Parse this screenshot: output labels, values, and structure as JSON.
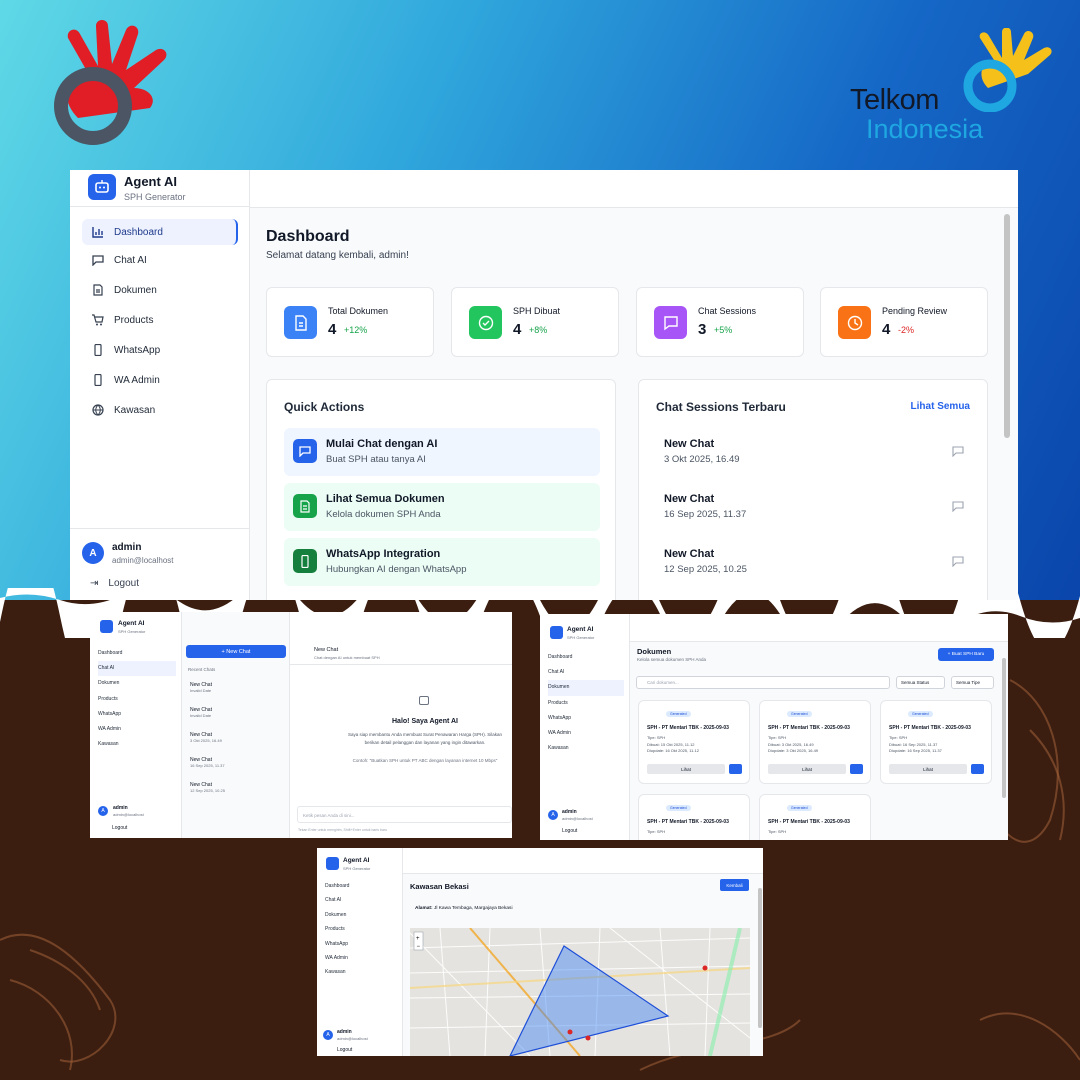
{
  "brand": {
    "name": "Telkom",
    "sub": "Indonesia"
  },
  "colors": {
    "accent": "#2563eb",
    "green": "#16a34a",
    "purple": "#a855f7",
    "orange": "#f97316",
    "brand_red": "#e11d25"
  },
  "app": {
    "title": "Agent AI",
    "subtitle": "SPH Generator"
  },
  "nav": [
    "Dashboard",
    "Chat AI",
    "Dokumen",
    "Products",
    "WhatsApp",
    "WA Admin",
    "Kawasan"
  ],
  "user": {
    "name": "admin",
    "email": "admin@localhost",
    "initial": "A",
    "logout": "Logout"
  },
  "dashboard": {
    "title": "Dashboard",
    "welcome": "Selamat datang kembali, admin!",
    "stats": [
      {
        "label": "Total Dokumen",
        "value": "4",
        "change": "+12%",
        "icon": "document-icon"
      },
      {
        "label": "SPH Dibuat",
        "value": "4",
        "change": "+8%",
        "icon": "check-circle-icon"
      },
      {
        "label": "Chat Sessions",
        "value": "3",
        "change": "+5%",
        "icon": "chat-icon"
      },
      {
        "label": "Pending Review",
        "value": "4",
        "change": "-2%",
        "icon": "clock-icon"
      }
    ],
    "quick_title": "Quick Actions",
    "quick": [
      {
        "title": "Mulai Chat dengan AI",
        "desc": "Buat SPH atau tanya AI"
      },
      {
        "title": "Lihat Semua Dokumen",
        "desc": "Kelola dokumen SPH Anda"
      },
      {
        "title": "WhatsApp Integration",
        "desc": "Hubungkan AI dengan WhatsApp"
      }
    ],
    "sessions_title": "Chat Sessions Terbaru",
    "see_all": "Lihat Semua",
    "sessions": [
      {
        "title": "New Chat",
        "date": "3 Okt 2025, 16.49"
      },
      {
        "title": "New Chat",
        "date": "16 Sep 2025, 11.37"
      },
      {
        "title": "New Chat",
        "date": "12 Sep 2025, 10.25"
      }
    ]
  },
  "chat": {
    "new_chat": "+ New Chat",
    "recent": "Recent Chats",
    "items": [
      {
        "t": "New Chat",
        "d": "Invalid Date"
      },
      {
        "t": "New Chat",
        "d": "Invalid Date"
      },
      {
        "t": "New Chat",
        "d": "3 Okt 2025, 16.49"
      },
      {
        "t": "New Chat",
        "d": "16 Sep 2025, 11.37"
      },
      {
        "t": "New Chat",
        "d": "12 Sep 2025, 10.25"
      }
    ],
    "header_title": "New Chat",
    "header_sub": "Chat dengan AI untuk membuat SPH",
    "hello": "Halo! Saya Agent AI",
    "intro": "Saya siap membantu Anda membuat Surat Penawaran Harga (SPH). Silakan berikan detail pelanggan dan layanan yang ingin ditawarkan.",
    "example": "Contoh: \"Buatkan SPH untuk PT ABC dengan layanan internet 10 Mbps\"",
    "placeholder": "Ketik pesan Anda di sini...",
    "hint": "Tekan Enter untuk mengirim, Shift+Enter untuk baris baru"
  },
  "docs": {
    "title": "Dokumen",
    "sub": "Kelola semua dokumen SPH Anda",
    "new_btn": "+ Buat SPH Baru",
    "search": "Cari dokumen...",
    "status": "Semua Status",
    "type": "Semua Tipe",
    "badge": "Generated",
    "view": "Lihat",
    "cards": [
      {
        "title": "SPH - PT Mentari TBK - 2025-09-03",
        "type": "Tipe: SPH",
        "created": "Dibuat: 15 Okt 2025, 11.12",
        "updated": "Diupdate: 16 Okt 2025, 11.12"
      },
      {
        "title": "SPH - PT Mentari TBK - 2025-09-03",
        "type": "Tipe: SPH",
        "created": "Dibuat: 3 Okt 2025, 16.49",
        "updated": "Diupdate: 3 Okt 2025, 16.49"
      },
      {
        "title": "SPH - PT Mentari TBK - 2025-09-03",
        "type": "Tipe: SPH",
        "created": "Dibuat: 16 Sep 2025, 11.37",
        "updated": "Diupdate: 16 Sep 2025, 11.37"
      },
      {
        "title": "SPH - PT Mentari TBK - 2025-09-03",
        "type": "Tipe: SPH"
      },
      {
        "title": "SPH - PT Mentari TBK - 2025-09-03",
        "type": "Tipe: SPH"
      }
    ]
  },
  "kawasan": {
    "title": "Kawasan Bekasi",
    "back": "Kembali",
    "addr_label": "Alamat:",
    "addr": "Jl Kawa Tembaga, Margajaya Bekasi"
  }
}
